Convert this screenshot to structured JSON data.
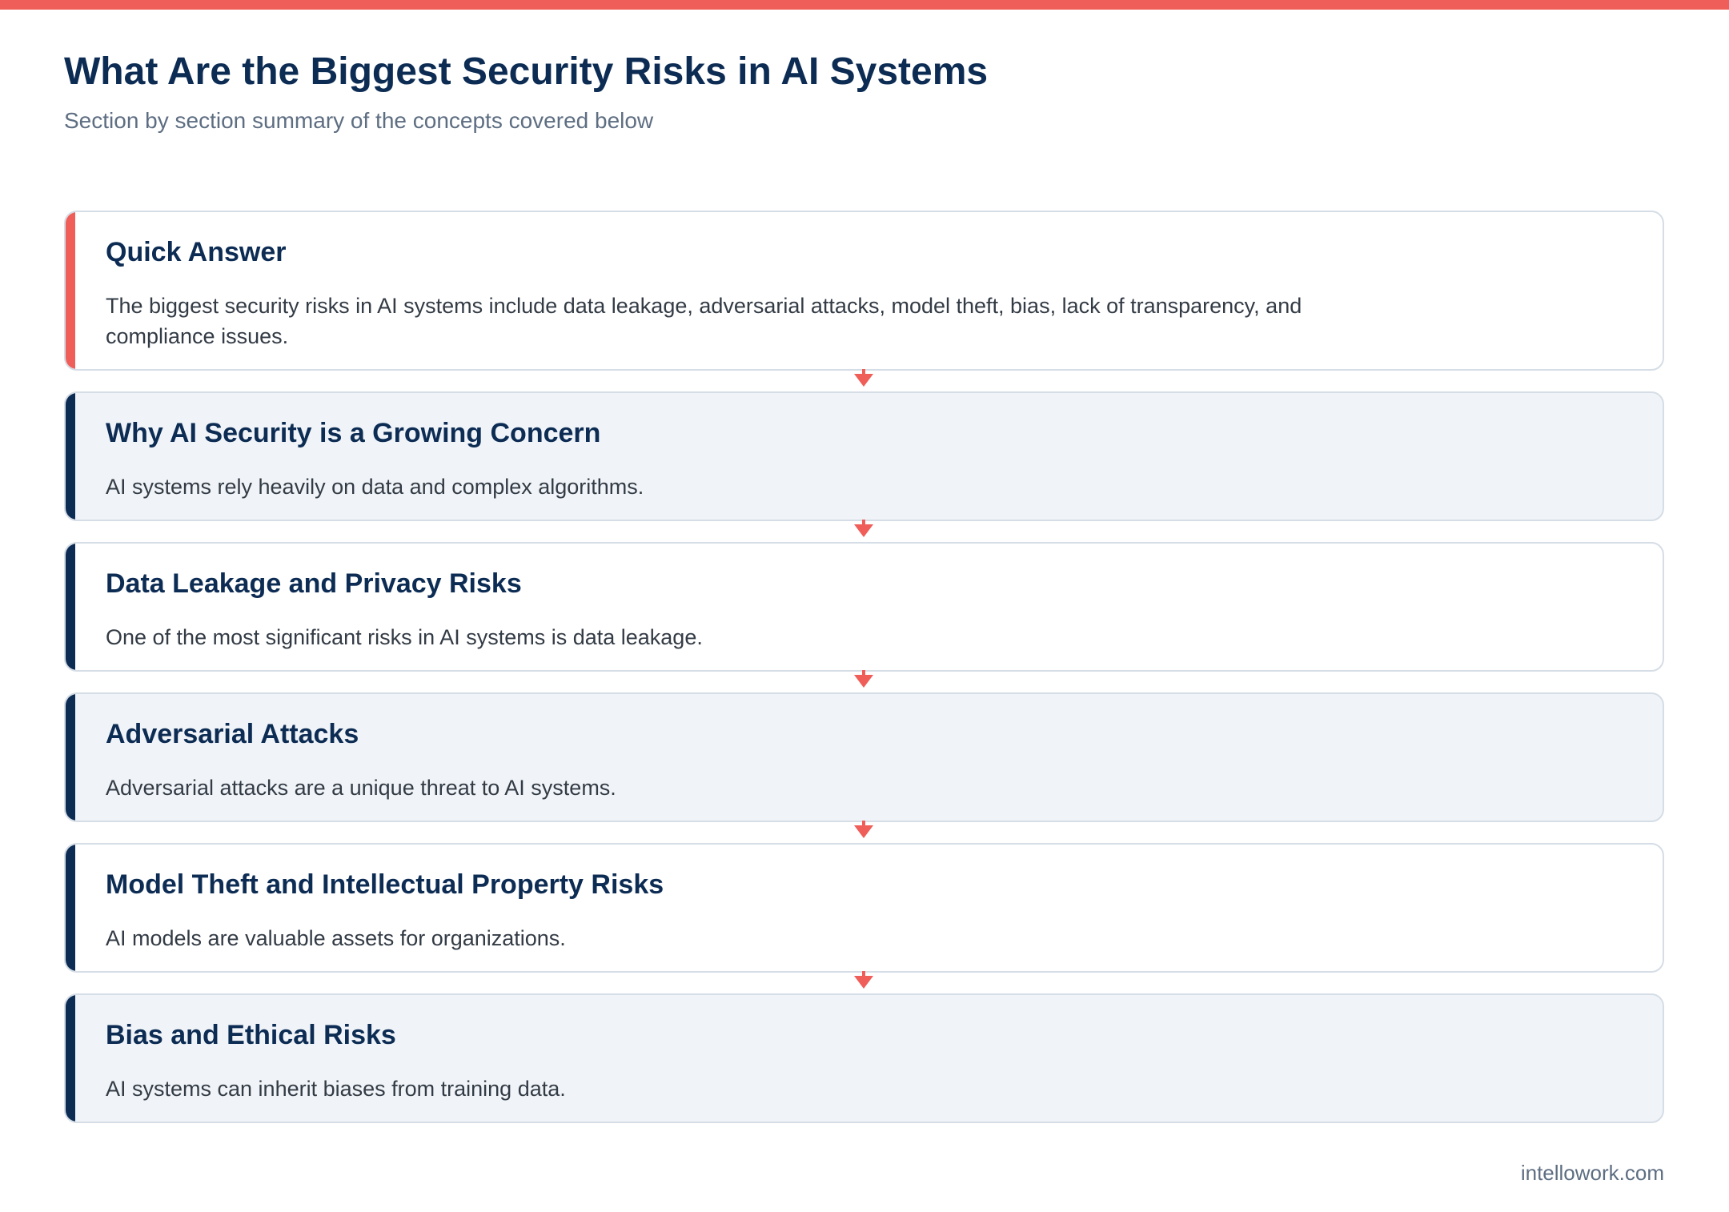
{
  "header": {
    "title": "What Are the Biggest Security Risks in AI Systems",
    "subtitle": "Section by section summary of the concepts covered below"
  },
  "cards": [
    {
      "title": "Quick Answer",
      "text": "The biggest security risks in AI systems include data leakage, adversarial attacks, model theft, bias, lack of transparency, and compliance issues."
    },
    {
      "title": "Why AI Security is a Growing Concern",
      "text": "AI systems rely heavily on data and complex algorithms."
    },
    {
      "title": "Data Leakage and Privacy Risks",
      "text": "One of the most significant risks in AI systems is data leakage."
    },
    {
      "title": "Adversarial Attacks",
      "text": "Adversarial attacks are a unique threat to AI systems."
    },
    {
      "title": "Model Theft and Intellectual Property Risks",
      "text": "AI models are valuable assets for organizations."
    },
    {
      "title": "Bias and Ethical Risks",
      "text": "AI systems can inherit biases from training data."
    }
  ],
  "footer": {
    "source": "intellowork.com"
  },
  "colors": {
    "accent_red": "#EF5E58",
    "navy": "#0D2C54",
    "card_tint": "#F0F4F8",
    "border": "#D5DDE6"
  }
}
